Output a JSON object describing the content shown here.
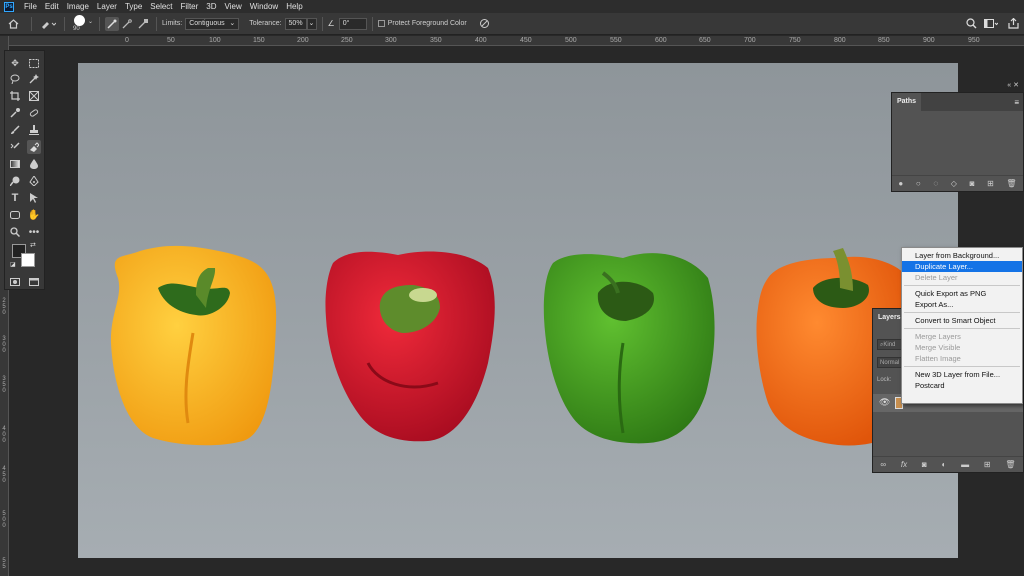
{
  "app": {
    "logo_text": "Ps"
  },
  "menu": [
    "File",
    "Edit",
    "Image",
    "Layer",
    "Type",
    "Select",
    "Filter",
    "3D",
    "View",
    "Window",
    "Help"
  ],
  "options_bar": {
    "brush_size": "90",
    "limits_label": "Limits:",
    "limits_value": "Contiguous",
    "tolerance_label": "Tolerance:",
    "tolerance_value": "50%",
    "angle_value": "0°",
    "protect_label": "Protect Foreground Color"
  },
  "ruler_h": [
    "0",
    "50",
    "100",
    "150",
    "200",
    "250",
    "300",
    "350",
    "400",
    "450",
    "500",
    "550",
    "600",
    "650",
    "700",
    "750",
    "800",
    "850",
    "900",
    "950"
  ],
  "ruler_v": [
    "2\n5\n0",
    "3\n0\n0",
    "3\n5\n0",
    "4\n0\n0",
    "4\n5\n0",
    "5\n0\n0",
    "5\n5"
  ],
  "paths_panel": {
    "title": "Paths"
  },
  "layers_panel": {
    "title": "Layers",
    "kind_placeholder": "Kind",
    "blend_mode": "Normal",
    "lock_label": "Lock:"
  },
  "context_menu": {
    "items": [
      {
        "label": "Layer from Background...",
        "state": "normal"
      },
      {
        "label": "Duplicate Layer...",
        "state": "highlight"
      },
      {
        "label": "Delete Layer",
        "state": "disabled"
      },
      {
        "sep": true
      },
      {
        "label": "Quick Export as PNG",
        "state": "normal"
      },
      {
        "label": "Export As...",
        "state": "normal"
      },
      {
        "sep": true
      },
      {
        "label": "Convert to Smart Object",
        "state": "normal"
      },
      {
        "sep": true
      },
      {
        "label": "Merge Layers",
        "state": "disabled"
      },
      {
        "label": "Merge Visible",
        "state": "disabled"
      },
      {
        "label": "Flatten Image",
        "state": "disabled"
      },
      {
        "sep": true
      },
      {
        "label": "New 3D Layer from File...",
        "state": "normal"
      },
      {
        "label": "Postcard",
        "state": "normal"
      }
    ]
  },
  "colors": {
    "accent": "#1473e6",
    "panel_bg": "#535353",
    "canvas": "#9aa1a6",
    "pepper_yellow": "#f5a31a",
    "pepper_red": "#c8102e",
    "pepper_green": "#3f9a22",
    "pepper_orange": "#f26a12"
  }
}
